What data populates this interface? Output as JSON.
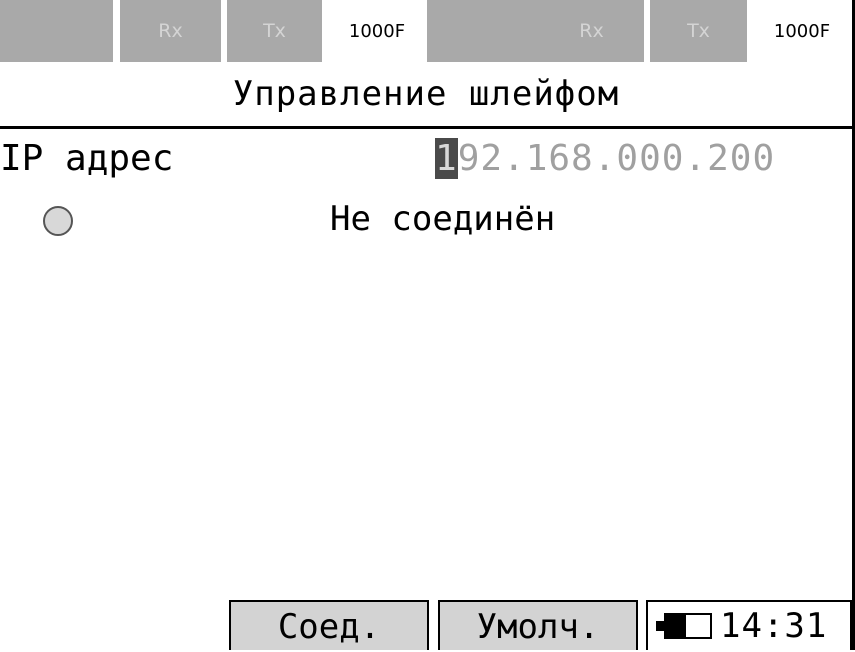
{
  "status_bar": {
    "port1": {
      "rx": "Rx",
      "tx": "Tx",
      "speed": "1000F"
    },
    "port2": {
      "rx": "Rx",
      "tx": "Tx",
      "speed": "1000F"
    }
  },
  "title": "Управление шлейфом",
  "ip": {
    "label": "IP адрес",
    "cursor_char": "1",
    "rest": "92.168.000.200"
  },
  "connection": {
    "status_text": "Не соединён"
  },
  "footer": {
    "connect_label": "Соед.",
    "default_label": "Умолч.",
    "clock": "14:31"
  },
  "colors": {
    "indicator_bg": "#a9a9a9",
    "indicator_text_inactive": "#d4d4d4",
    "button_bg": "#d3d3d3",
    "ip_text": "#a0a0a0"
  },
  "icons": {
    "connection": "status-circle-icon",
    "battery": "battery-icon"
  }
}
